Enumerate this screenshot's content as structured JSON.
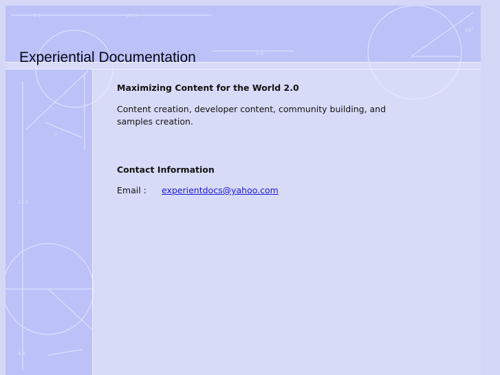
{
  "site": {
    "title": "Experiential Documentation"
  },
  "main": {
    "tagline_heading": "Maximizing Content for the World 2.0",
    "description": "Content creation, developer content, community building, and samples creation.",
    "contact_heading": "Contact Information",
    "email_label": "Email :",
    "email_value": "experientdocs@yahoo.com "
  },
  "colors": {
    "page_background": "#d4d8f6",
    "blueprint_band": "#bcc2f8",
    "link": "#1a1ad8"
  }
}
